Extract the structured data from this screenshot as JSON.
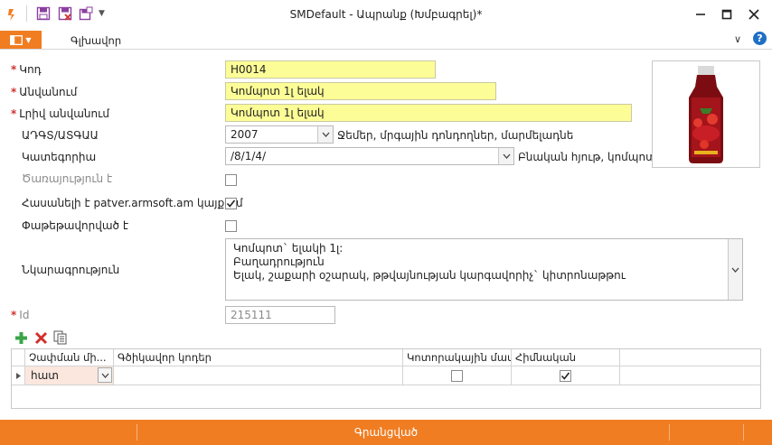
{
  "window": {
    "title": "SMDefault - Ապրանք (Խմբագրել)*"
  },
  "ribbon": {
    "tab_main": "Գլխավոր",
    "help_glyph": "?"
  },
  "form": {
    "code": {
      "label": "Կոդ",
      "value": "H0014"
    },
    "name": {
      "label": "Անվանում",
      "value": "Կոմպոտ 1լ ելակ"
    },
    "full_name": {
      "label": "Լրիվ անվանում",
      "value": "Կոմպոտ 1լ ելակ"
    },
    "adgs": {
      "label": "ԱԴԳՏ/ԱՏԳԱԱ",
      "value": "2007",
      "description": "Ջեմեր, մրգային դոնդողներ, մարմելադնե"
    },
    "category": {
      "label": "Կատեգորիա",
      "value": "/8/1/4/",
      "description": "Բնական հյութ, կոմպոտ"
    },
    "is_service": {
      "label": "Ծառայություն է",
      "checked": false
    },
    "available_on_site": {
      "label": "Հասանելի է patver.armsoft.am կայքում",
      "checked": true
    },
    "packed": {
      "label": "Փաթեթավորված է",
      "checked": false
    },
    "description": {
      "label": "Նկարագրություն",
      "lines": [
        "Կոմպոտ` ելակի 1լ:",
        "Բաղադրություն",
        "Ելակ, շաքարի օշարակ, թթվայնության կարգավորիչ` կիտրոնաթթու"
      ]
    },
    "id": {
      "label": "Id",
      "value": "215111"
    }
  },
  "grid": {
    "columns": [
      "Չափման մի...",
      "Գծիկավոր կոդեր",
      "Կոտորակային մաս",
      "Հիմնական"
    ],
    "rows": [
      {
        "unit": "հատ",
        "barcodes": "",
        "fractional": false,
        "primary": true
      }
    ]
  },
  "statusbar": {
    "text": "Գրանցված"
  },
  "colors": {
    "accent": "#f07d22",
    "required": "#d0312d",
    "highlight_field": "#fdfd98",
    "help": "#1f6fc5"
  }
}
